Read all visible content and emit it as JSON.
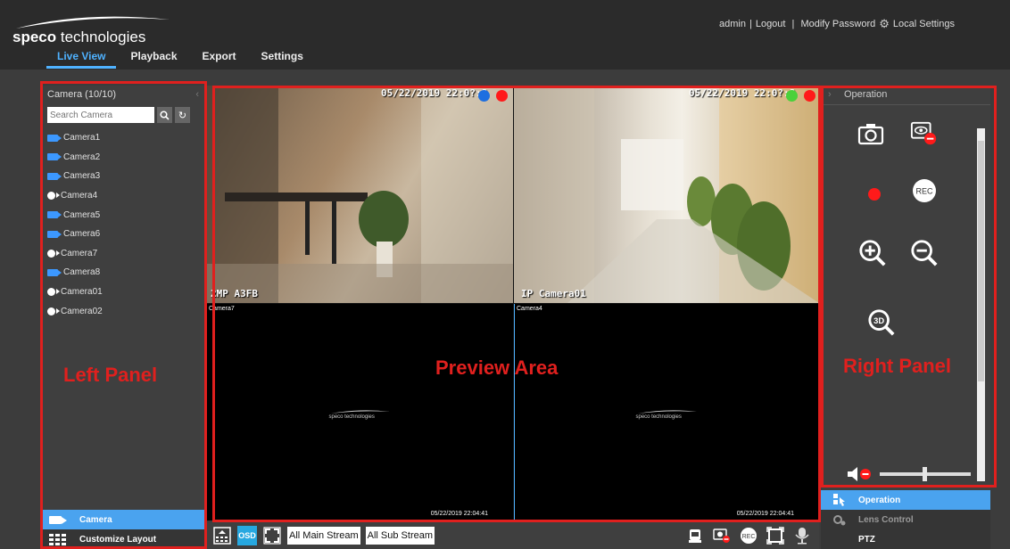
{
  "header": {
    "brand_bold": "speco",
    "brand_rest": " technologies",
    "user": "admin",
    "logout": "Logout",
    "modify_password": "Modify Password",
    "local_settings": "Local Settings",
    "nav": [
      {
        "label": "Live View",
        "active": true
      },
      {
        "label": "Playback",
        "active": false
      },
      {
        "label": "Export",
        "active": false
      },
      {
        "label": "Settings",
        "active": false
      }
    ]
  },
  "left_panel": {
    "title": "Camera (10/10)",
    "search_placeholder": "Search Camera",
    "cameras": [
      {
        "name": "Camera1",
        "type": "bullet"
      },
      {
        "name": "Camera2",
        "type": "bullet"
      },
      {
        "name": "Camera3",
        "type": "bullet"
      },
      {
        "name": "Camera4",
        "type": "ptz"
      },
      {
        "name": "Camera5",
        "type": "bullet"
      },
      {
        "name": "Camera6",
        "type": "bullet"
      },
      {
        "name": "Camera7",
        "type": "ptz"
      },
      {
        "name": "Camera8",
        "type": "bullet"
      },
      {
        "name": "Camera01",
        "type": "ptz"
      },
      {
        "name": "Camera02",
        "type": "ptz"
      }
    ],
    "bottom_tabs": [
      {
        "label": "Camera",
        "active": true
      },
      {
        "label": "Customize Layout",
        "active": false
      }
    ]
  },
  "preview": {
    "cells": [
      {
        "osd_time": "05/22/2019 22:0?:?",
        "osd_name": "2MP A3FB",
        "label": "",
        "footer_time": ""
      },
      {
        "osd_time": "05/22/2019 22:0?:?",
        "osd_name": "IP Camera01",
        "label": "",
        "footer_time": ""
      },
      {
        "osd_time": "",
        "osd_name": "",
        "label": "Camera7",
        "logo": "speco technologies",
        "footer_time": "05/22/2019 22:04:41"
      },
      {
        "osd_time": "",
        "osd_name": "",
        "label": "Camera4",
        "logo": "speco technologies",
        "footer_time": "05/22/2019 22:04:41"
      }
    ]
  },
  "toolbar": {
    "osd": "OSD",
    "main_stream": "All Main Stream",
    "sub_stream": "All Sub Stream"
  },
  "right_panel": {
    "title": "Operation",
    "rec_label": "REC",
    "zoom_3d_label": "3D",
    "bottom_tabs": [
      {
        "label": "Operation",
        "active": true
      },
      {
        "label": "Lens Control",
        "active": false
      },
      {
        "label": "PTZ",
        "active": false
      }
    ]
  },
  "annotations": {
    "left": "Left Panel",
    "preview": "Preview Area",
    "right": "Right Panel"
  },
  "colors": {
    "accent": "#4aa3ef",
    "annotation": "#e0201e",
    "record": "#ff1a1a"
  }
}
